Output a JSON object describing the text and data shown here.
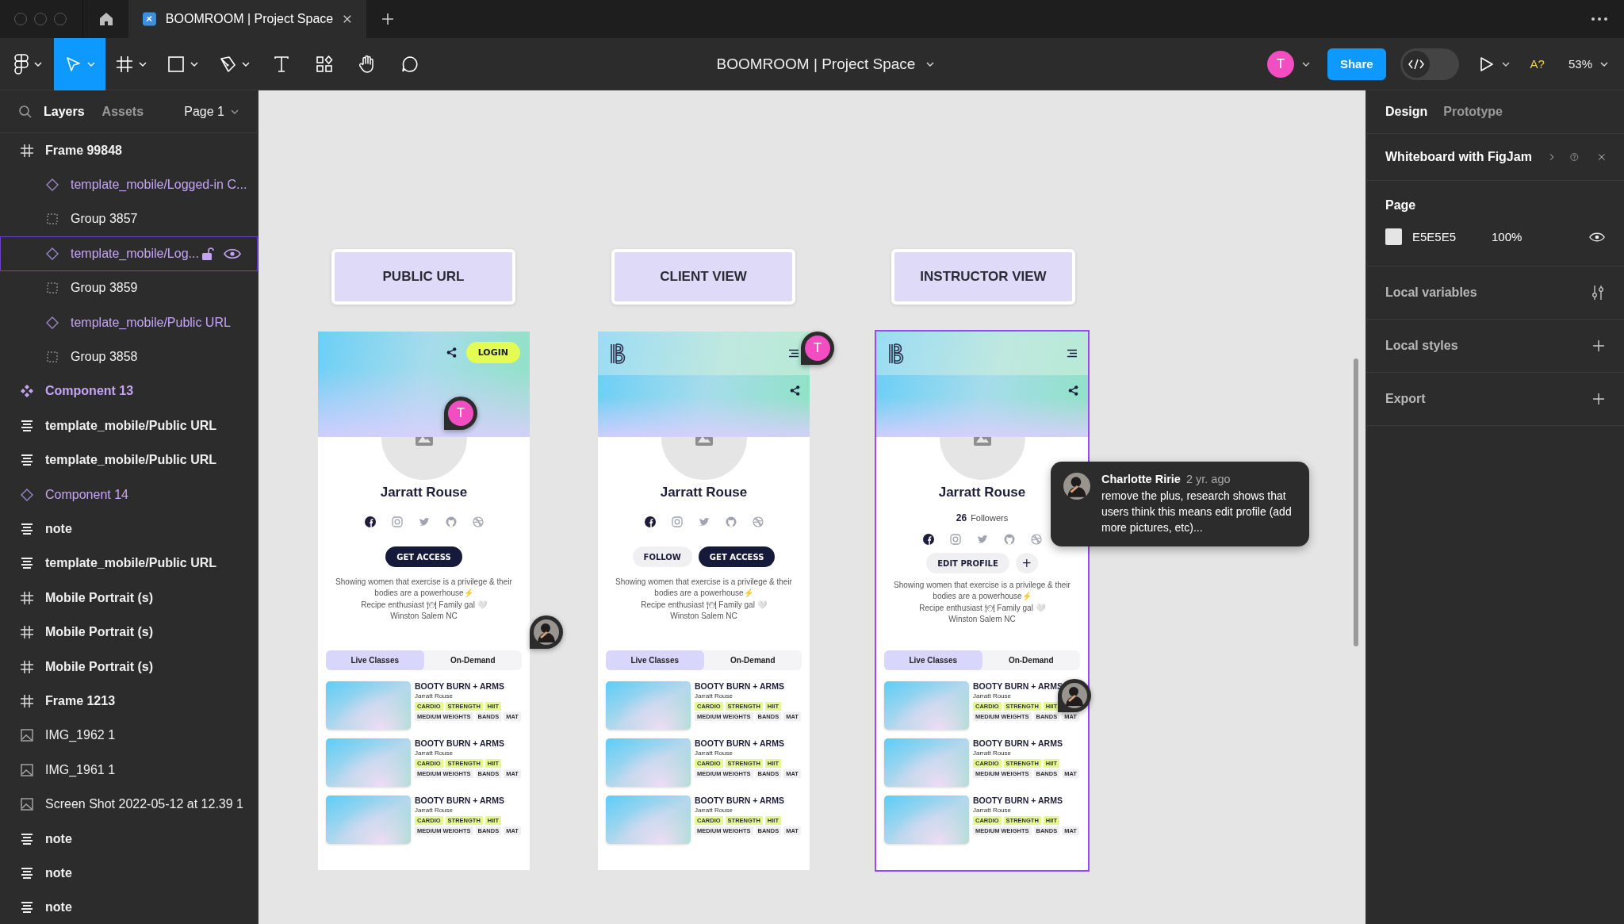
{
  "window": {
    "tab_title": "BOOMROOM | Project Space"
  },
  "toolbar": {
    "tools": [
      {
        "kind": "main-menu",
        "selected": false
      },
      {
        "kind": "move",
        "selected": true
      },
      {
        "kind": "frame",
        "selected": false
      },
      {
        "kind": "shape",
        "selected": false
      },
      {
        "kind": "pen",
        "selected": false
      },
      {
        "kind": "text",
        "selected": false
      },
      {
        "kind": "resources",
        "selected": false
      },
      {
        "kind": "hand",
        "selected": false
      },
      {
        "kind": "comment",
        "selected": false
      }
    ],
    "file_title": "BOOMROOM | Project Space",
    "dev_mode": {
      "on": false
    },
    "user_initial": "T",
    "share": "Share",
    "font_status": "A?",
    "zoom": "53%"
  },
  "layers_panel": {
    "tabs": [
      {
        "label": "Layers",
        "selected": true
      },
      {
        "label": "Assets",
        "selected": false
      }
    ],
    "page": "Page 1",
    "layers": [
      {
        "kind": "frame",
        "name": "Frame 99848",
        "selected": false,
        "children": [
          {
            "kind": "instance",
            "name": "template_mobile/Logged-in C...",
            "selected": false
          },
          {
            "kind": "group",
            "name": "Group 3857",
            "selected": false
          },
          {
            "kind": "instance",
            "name": "template_mobile/Log...",
            "selected": true
          },
          {
            "kind": "group",
            "name": "Group 3859",
            "selected": false
          },
          {
            "kind": "instance",
            "name": "template_mobile/Public URL",
            "selected": false
          },
          {
            "kind": "group",
            "name": "Group 3858",
            "selected": false
          }
        ]
      },
      {
        "kind": "component",
        "name": "Component 13",
        "selected": false
      },
      {
        "kind": "text",
        "name": "template_mobile/Public URL",
        "selected": false
      },
      {
        "kind": "text",
        "name": "template_mobile/Public URL",
        "selected": false
      },
      {
        "kind": "instance",
        "name": "Component 14",
        "selected": false
      },
      {
        "kind": "text",
        "name": "note",
        "selected": false
      },
      {
        "kind": "text",
        "name": "template_mobile/Public URL",
        "selected": false
      },
      {
        "kind": "frame",
        "name": "Mobile Portrait (s)",
        "selected": false
      },
      {
        "kind": "frame",
        "name": "Mobile Portrait (s)",
        "selected": false
      },
      {
        "kind": "frame",
        "name": "Mobile Portrait (s)",
        "selected": false
      },
      {
        "kind": "frame",
        "name": "Frame 1213",
        "selected": false
      },
      {
        "kind": "image",
        "name": "IMG_1962 1",
        "selected": false
      },
      {
        "kind": "image",
        "name": "IMG_1961 1",
        "selected": false
      },
      {
        "kind": "image",
        "name": "Screen Shot 2022-05-12 at 12.39 1",
        "selected": false
      },
      {
        "kind": "text",
        "name": "note",
        "selected": false
      },
      {
        "kind": "text",
        "name": "note",
        "selected": false
      },
      {
        "kind": "text",
        "name": "note",
        "selected": false
      }
    ]
  },
  "canvas": {
    "frames": [
      {
        "label": "PUBLIC URL",
        "selected": false,
        "header": {
          "kind": "public",
          "login": "LOGIN"
        },
        "name": "Jarratt Rouse",
        "actions": [
          {
            "kind": "primary",
            "label": "GET ACCESS"
          }
        ],
        "bio": [
          "Showing women that exercise is a privilege & their",
          "bodies are a powerhouse⚡",
          "Recipe enthusiast 🍽 Family gal 🤍",
          "Winston Salem NC"
        ],
        "tabs": [
          {
            "label": "Live Classes",
            "selected": true
          },
          {
            "label": "On-Demand",
            "selected": false
          }
        ],
        "classes": [
          {
            "title": "BOOTY BURN + ARMS",
            "instructor": "Jarratt Rouse",
            "tags": [
              {
                "kind": "type",
                "label": "CARDIO"
              },
              {
                "kind": "type",
                "label": "STRENGTH"
              },
              {
                "kind": "type",
                "label": "HIIT"
              },
              {
                "kind": "equipment",
                "label": "MEDIUM WEIGHTS"
              },
              {
                "kind": "equipment",
                "label": "BANDS"
              },
              {
                "kind": "equipment",
                "label": "MAT"
              }
            ]
          },
          {
            "title": "BOOTY BURN + ARMS",
            "instructor": "Jarratt Rouse",
            "tags": [
              {
                "kind": "type",
                "label": "CARDIO"
              },
              {
                "kind": "type",
                "label": "STRENGTH"
              },
              {
                "kind": "type",
                "label": "HIIT"
              },
              {
                "kind": "equipment",
                "label": "MEDIUM WEIGHTS"
              },
              {
                "kind": "equipment",
                "label": "BANDS"
              },
              {
                "kind": "equipment",
                "label": "MAT"
              }
            ]
          },
          {
            "title": "BOOTY BURN + ARMS",
            "instructor": "Jarratt Rouse",
            "tags": [
              {
                "kind": "type",
                "label": "CARDIO"
              },
              {
                "kind": "type",
                "label": "STRENGTH"
              },
              {
                "kind": "type",
                "label": "HIIT"
              },
              {
                "kind": "equipment",
                "label": "MEDIUM WEIGHTS"
              },
              {
                "kind": "equipment",
                "label": "BANDS"
              },
              {
                "kind": "equipment",
                "label": "MAT"
              }
            ]
          }
        ]
      },
      {
        "label": "CLIENT VIEW",
        "selected": false,
        "header": {
          "kind": "member"
        },
        "name": "Jarratt Rouse",
        "actions": [
          {
            "kind": "secondary",
            "label": "FOLLOW"
          },
          {
            "kind": "primary",
            "label": "GET ACCESS"
          }
        ],
        "bio": [
          "Showing women that exercise is a privilege & their",
          "bodies are a powerhouse⚡",
          "Recipe enthusiast 🍽 Family gal 🤍",
          "Winston Salem NC"
        ],
        "tabs": [
          {
            "label": "Live Classes",
            "selected": true
          },
          {
            "label": "On-Demand",
            "selected": false
          }
        ],
        "classes": [
          {
            "title": "BOOTY BURN + ARMS",
            "instructor": "Jarratt Rouse",
            "tags": [
              {
                "kind": "type",
                "label": "CARDIO"
              },
              {
                "kind": "type",
                "label": "STRENGTH"
              },
              {
                "kind": "type",
                "label": "HIIT"
              },
              {
                "kind": "equipment",
                "label": "MEDIUM WEIGHTS"
              },
              {
                "kind": "equipment",
                "label": "BANDS"
              },
              {
                "kind": "equipment",
                "label": "MAT"
              }
            ]
          },
          {
            "title": "BOOTY BURN + ARMS",
            "instructor": "Jarratt Rouse",
            "tags": [
              {
                "kind": "type",
                "label": "CARDIO"
              },
              {
                "kind": "type",
                "label": "STRENGTH"
              },
              {
                "kind": "type",
                "label": "HIIT"
              },
              {
                "kind": "equipment",
                "label": "MEDIUM WEIGHTS"
              },
              {
                "kind": "equipment",
                "label": "BANDS"
              },
              {
                "kind": "equipment",
                "label": "MAT"
              }
            ]
          },
          {
            "title": "BOOTY BURN + ARMS",
            "instructor": "Jarratt Rouse",
            "tags": [
              {
                "kind": "type",
                "label": "CARDIO"
              },
              {
                "kind": "type",
                "label": "STRENGTH"
              },
              {
                "kind": "type",
                "label": "HIIT"
              },
              {
                "kind": "equipment",
                "label": "MEDIUM WEIGHTS"
              },
              {
                "kind": "equipment",
                "label": "BANDS"
              },
              {
                "kind": "equipment",
                "label": "MAT"
              }
            ]
          }
        ]
      },
      {
        "label": "INSTRUCTOR VIEW",
        "selected": true,
        "header": {
          "kind": "member"
        },
        "name": "Jarratt Rouse",
        "followers": {
          "count": "26",
          "label": "Followers"
        },
        "actions": [
          {
            "kind": "secondary",
            "label": "EDIT PROFILE"
          },
          {
            "kind": "round",
            "label": "+"
          }
        ],
        "bio": [
          "Showing women that exercise is a privilege & their",
          "bodies are a powerhouse⚡",
          "Recipe enthusiast 🍽 Family gal 🤍",
          "Winston Salem NC"
        ],
        "tabs": [
          {
            "label": "Live Classes",
            "selected": true
          },
          {
            "label": "On-Demand",
            "selected": false
          }
        ],
        "classes": [
          {
            "title": "BOOTY BURN + ARMS",
            "instructor": "Jarratt Rouse",
            "tags": [
              {
                "kind": "type",
                "label": "CARDIO"
              },
              {
                "kind": "type",
                "label": "STRENGTH"
              },
              {
                "kind": "type",
                "label": "HIIT"
              },
              {
                "kind": "equipment",
                "label": "MEDIUM WEIGHTS"
              },
              {
                "kind": "equipment",
                "label": "BANDS"
              },
              {
                "kind": "equipment",
                "label": "MAT"
              }
            ]
          },
          {
            "title": "BOOTY BURN + ARMS",
            "instructor": "Jarratt Rouse",
            "tags": [
              {
                "kind": "type",
                "label": "CARDIO"
              },
              {
                "kind": "type",
                "label": "STRENGTH"
              },
              {
                "kind": "type",
                "label": "HIIT"
              },
              {
                "kind": "equipment",
                "label": "MEDIUM WEIGHTS"
              },
              {
                "kind": "equipment",
                "label": "BANDS"
              },
              {
                "kind": "equipment",
                "label": "MAT"
              }
            ]
          },
          {
            "title": "BOOTY BURN + ARMS",
            "instructor": "Jarratt Rouse",
            "tags": [
              {
                "kind": "type",
                "label": "CARDIO"
              },
              {
                "kind": "type",
                "label": "STRENGTH"
              },
              {
                "kind": "type",
                "label": "HIIT"
              },
              {
                "kind": "equipment",
                "label": "MEDIUM WEIGHTS"
              },
              {
                "kind": "equipment",
                "label": "BANDS"
              },
              {
                "kind": "equipment",
                "label": "MAT"
              }
            ]
          }
        ]
      }
    ],
    "comment_pins": [
      {
        "kind": "initial",
        "text": "T"
      },
      {
        "kind": "initial",
        "text": "T"
      },
      {
        "kind": "photo"
      },
      {
        "kind": "photo"
      }
    ],
    "comment": {
      "author": "Charlotte Ririe",
      "time": "2 yr. ago",
      "message": "remove the plus, research shows that users think this means edit profile (add more pictures, etc)..."
    }
  },
  "design_panel": {
    "tabs": [
      {
        "label": "Design",
        "selected": true
      },
      {
        "label": "Prototype",
        "selected": false
      }
    ],
    "banner": "Whiteboard with FigJam",
    "sections": [
      {
        "kind": "page",
        "title": "Page",
        "hex": "E5E5E5",
        "opacity": "100%"
      },
      {
        "kind": "variables",
        "title": "Local variables"
      },
      {
        "kind": "add",
        "title": "Local styles"
      },
      {
        "kind": "add",
        "title": "Export"
      }
    ]
  }
}
